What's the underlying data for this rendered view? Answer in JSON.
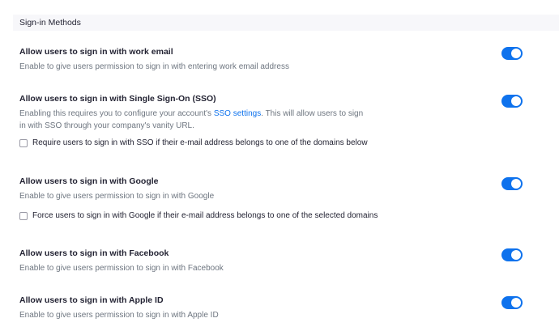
{
  "section": {
    "title": "Sign-in Methods"
  },
  "settings": [
    {
      "title": "Allow users to sign in with work email",
      "desc": "Enable to give users permission to sign in with entering work email address",
      "enabled": true
    },
    {
      "title": "Allow users to sign in with Single Sign-On (SSO)",
      "desc_before": "Enabling this requires you to configure your account's ",
      "link": "SSO settings",
      "desc_after": ". This will allow users to sign in with SSO through your company's vanity URL.",
      "checkbox_label": "Require users to sign in with SSO if their e-mail address belongs to one of the domains below",
      "checked": false,
      "enabled": true
    },
    {
      "title": "Allow users to sign in with Google",
      "desc": "Enable to give users permission to sign in with Google",
      "checkbox_label": "Force users to sign in with Google if their e-mail address belongs to one of the selected domains",
      "checked": false,
      "enabled": true
    },
    {
      "title": "Allow users to sign in with Facebook",
      "desc": "Enable to give users permission to sign in with Facebook",
      "enabled": true
    },
    {
      "title": "Allow users to sign in with Apple ID",
      "desc": "Enable to give users permission to sign in with Apple ID",
      "enabled": true
    }
  ],
  "colors": {
    "accent": "#0e72ed",
    "header_bg": "#f7f7fa",
    "text": "#232333",
    "muted": "#6e7680"
  }
}
